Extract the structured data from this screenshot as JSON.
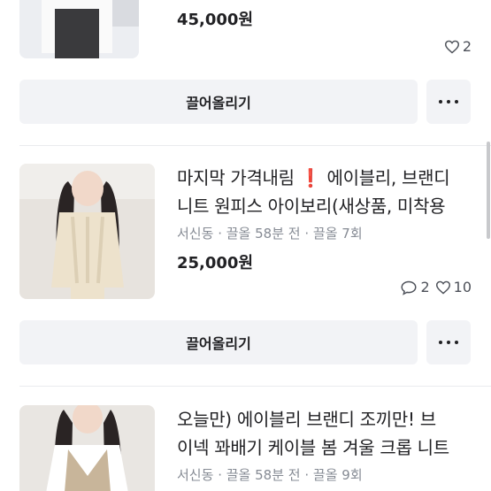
{
  "items": [
    {
      "price": "45,000원",
      "likes": "2",
      "bump_label": "끌어올리기"
    },
    {
      "title_line1_pre": "마지막 가격내림 ",
      "title_line1_excl": "❗",
      "title_line1_post": " 에이블리, 브랜디",
      "title_line2": "니트 원피스 아이보리(새상품, 미착용",
      "location": "서신동",
      "bump_info": "끌올 58분 전",
      "bump_count": "끌올 7회",
      "price": "25,000원",
      "chats": "2",
      "likes": "10",
      "bump_label": "끌어올리기"
    },
    {
      "title_line1": "오늘만) 에이블리 브랜디 조끼만! 브",
      "title_line2": "이넥 꽈배기 케이블 봄 겨울 크롭 니트",
      "location": "서신동",
      "bump_info": "끌올 58분 전",
      "bump_count": "끌올 9회"
    }
  ],
  "separator": "·",
  "icons": {
    "heart": "heart-icon",
    "chat": "chat-bubble-icon",
    "more": "more-dots-icon"
  },
  "colors": {
    "text": "#212124",
    "meta": "#868b94",
    "button_bg": "#f2f3f6",
    "alert": "#e53935"
  }
}
